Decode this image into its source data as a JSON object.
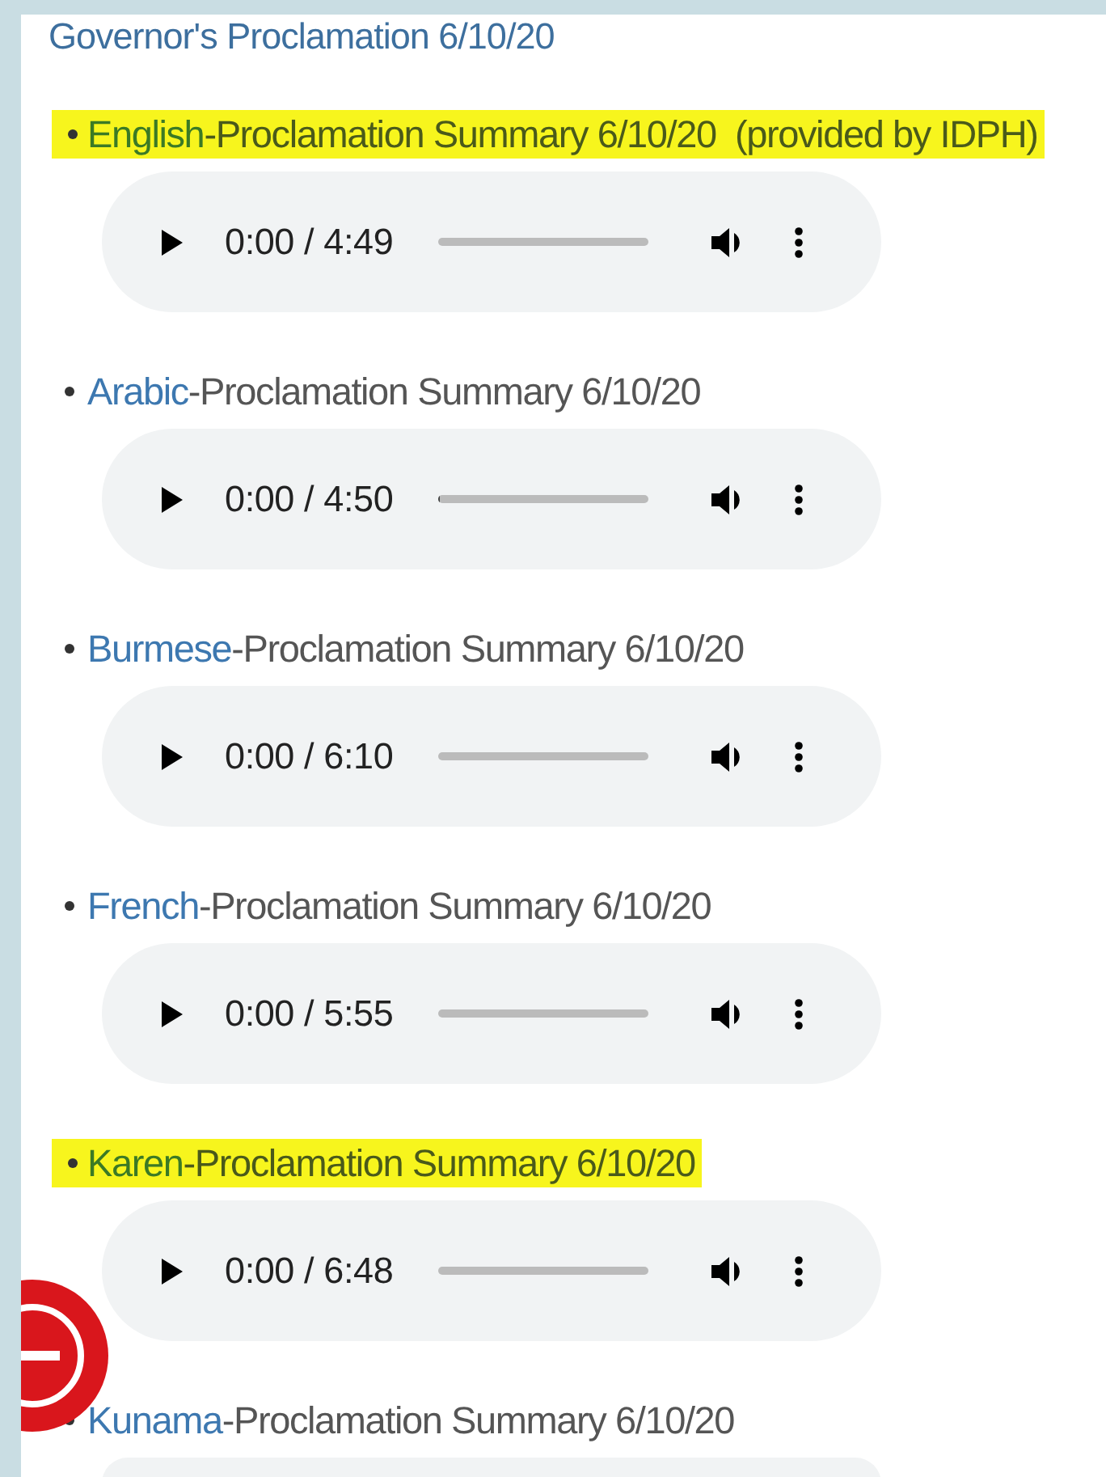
{
  "heading": "Governor's Proclamation 6/10/20",
  "items": [
    {
      "language": "English",
      "rest": "-Proclamation Summary 6/10/20  (provided by IDPH)",
      "highlighted": true,
      "player": {
        "time": "0:00 / 4:49",
        "level": 0
      }
    },
    {
      "language": "Arabic",
      "rest": "-Proclamation Summary 6/10/20",
      "highlighted": false,
      "player": {
        "time": "0:00 / 4:50",
        "level": 0.01
      }
    },
    {
      "language": "Burmese",
      "rest": "-Proclamation Summary 6/10/20",
      "highlighted": false,
      "player": {
        "time": "0:00 / 6:10",
        "level": 0
      }
    },
    {
      "language": "French",
      "rest": "-Proclamation Summary 6/10/20",
      "highlighted": false,
      "player": {
        "time": "0:00 / 5:55",
        "level": 0
      }
    },
    {
      "language": "Karen",
      "rest": "-Proclamation Summary 6/10/20",
      "highlighted": true,
      "player": {
        "time": "0:00 / 6:48",
        "level": 0
      }
    },
    {
      "language": "Kunama",
      "rest": "-Proclamation Summary 6/10/20",
      "highlighted": false,
      "player": {
        "kind": "cut"
      }
    }
  ],
  "floating_button": true
}
